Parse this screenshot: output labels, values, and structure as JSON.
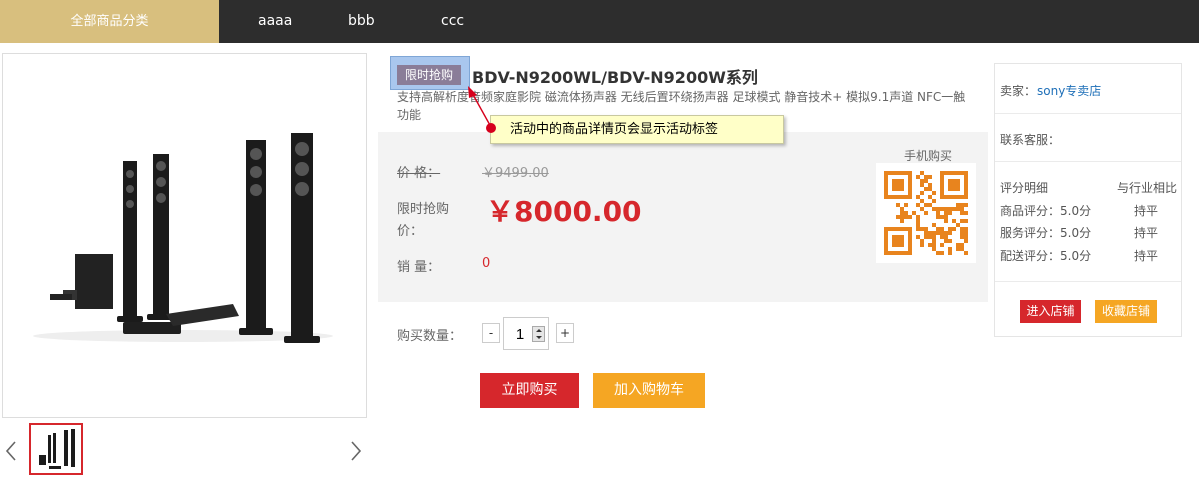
{
  "nav": {
    "category_label": "全部商品分类",
    "links": [
      "aaaa",
      "bbb",
      "ccc"
    ]
  },
  "product": {
    "promo_tag": "限时抢购",
    "title": "BDV-N9200WL/BDV-N9200W系列",
    "subtitle": "支持高解析度音频家庭影院 磁流体扬声器 无线后置环绕扬声器 足球模式 静音技术+ 模拟9.1声道 NFC一触功能",
    "price_label": "价 格：",
    "original_price": "￥9499.00",
    "flash_label_line1": "限时抢购",
    "flash_label_line2": "价：",
    "flash_price": "￥8000.00",
    "sales_label": "销 量：",
    "sales_value": "0",
    "mobile_buy_label": "手机购买",
    "quantity_label": "购买数量：",
    "quantity_value": "1",
    "minus": "-",
    "plus": "+",
    "buy_now": "立即购买",
    "add_to_cart": "加入购物车"
  },
  "tooltip": {
    "text": "活动中的商品详情页会显示活动标签"
  },
  "seller": {
    "seller_label": "卖家：",
    "seller_name": "sony专卖店",
    "service_label": "联系客服：",
    "rating_header": "评分明细",
    "compare_header": "与行业相比",
    "ratings": [
      {
        "label": "商品评分：5.0分",
        "compare": "持平"
      },
      {
        "label": "服务评分：5.0分",
        "compare": "持平"
      },
      {
        "label": "配送评分：5.0分",
        "compare": "持平"
      }
    ],
    "enter_store": "进入店铺",
    "favorite_store": "收藏店铺"
  },
  "colors": {
    "nav_bg": "#2d2d2d",
    "category_bg": "#d8bf7e",
    "price_red": "#d6272c",
    "cart_orange": "#f5a623",
    "link_blue": "#1e6fb8"
  },
  "icons": {
    "prev": "chevron-left-icon",
    "next": "chevron-right-icon"
  }
}
